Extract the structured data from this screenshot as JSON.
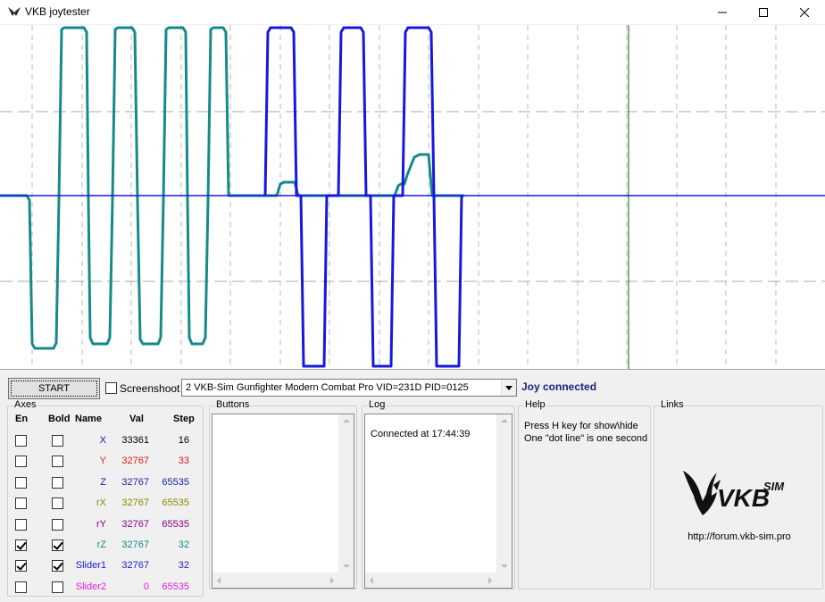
{
  "window": {
    "title": "VKB joytester"
  },
  "colors": {
    "x": "#1a1aa6",
    "y": "#e01818",
    "z": "#1a1aa6",
    "rx": "#8a8a00",
    "ry": "#8a008a",
    "rz": "#108a8a",
    "slider1": "#1a1acc",
    "slider2": "#e020e0",
    "status": "#1a237e",
    "trace_teal": "#168a8a",
    "trace_blue": "#1818dd",
    "cursor_line": "#007000",
    "zero_line": "#1818dd"
  },
  "toolbar": {
    "start_label": "START",
    "screenshot_label": "Screenshoot",
    "screenshot_checked": false,
    "device_selected": "2  VKB-Sim Gunfighter Modern Combat Pro  VID=231D PID=0125",
    "status": "Joy connected"
  },
  "axes": {
    "title": "Axes",
    "headers": {
      "en": "En",
      "bold": "Bold",
      "name": "Name",
      "val": "Val",
      "step": "Step"
    },
    "rows": [
      {
        "name": "X",
        "val": "33361",
        "step": "16",
        "en": false,
        "bold": false,
        "name_color": "#1a1aa6",
        "val_color": "#000000",
        "step_color": "#000000"
      },
      {
        "name": "Y",
        "val": "32767",
        "step": "33",
        "en": false,
        "bold": false,
        "name_color": "#e01818",
        "val_color": "#e01818",
        "step_color": "#e01818"
      },
      {
        "name": "Z",
        "val": "32767",
        "step": "65535",
        "en": false,
        "bold": false,
        "name_color": "#1a1aa6",
        "val_color": "#1a1aa6",
        "step_color": "#1a1aa6"
      },
      {
        "name": "rX",
        "val": "32767",
        "step": "65535",
        "en": false,
        "bold": false,
        "name_color": "#8a8a00",
        "val_color": "#8a8a00",
        "step_color": "#8a8a00"
      },
      {
        "name": "rY",
        "val": "32767",
        "step": "65535",
        "en": false,
        "bold": false,
        "name_color": "#8a008a",
        "val_color": "#8a008a",
        "step_color": "#8a008a"
      },
      {
        "name": "rZ",
        "val": "32767",
        "step": "32",
        "en": true,
        "bold": true,
        "name_color": "#108a8a",
        "val_color": "#108a8a",
        "step_color": "#108a8a"
      },
      {
        "name": "Slider1",
        "val": "32767",
        "step": "32",
        "en": true,
        "bold": true,
        "name_color": "#1a1acc",
        "val_color": "#1a1acc",
        "step_color": "#1a1acc"
      },
      {
        "name": "Slider2",
        "val": "0",
        "step": "65535",
        "en": false,
        "bold": false,
        "name_color": "#e020e0",
        "val_color": "#e020e0",
        "step_color": "#e020e0"
      }
    ]
  },
  "buttons_panel": {
    "title": "Buttons"
  },
  "log_panel": {
    "title": "Log",
    "lines": [
      "Connected at 17:44:39"
    ]
  },
  "help_panel": {
    "title": "Help",
    "lines": [
      "Press H key for show\\hide",
      "One \"dot line\" is one second"
    ]
  },
  "links_panel": {
    "title": "Links",
    "url": "http://forum.vkb-sim.pro",
    "logo_text": "VKB",
    "logo_sup": "SIM"
  }
}
